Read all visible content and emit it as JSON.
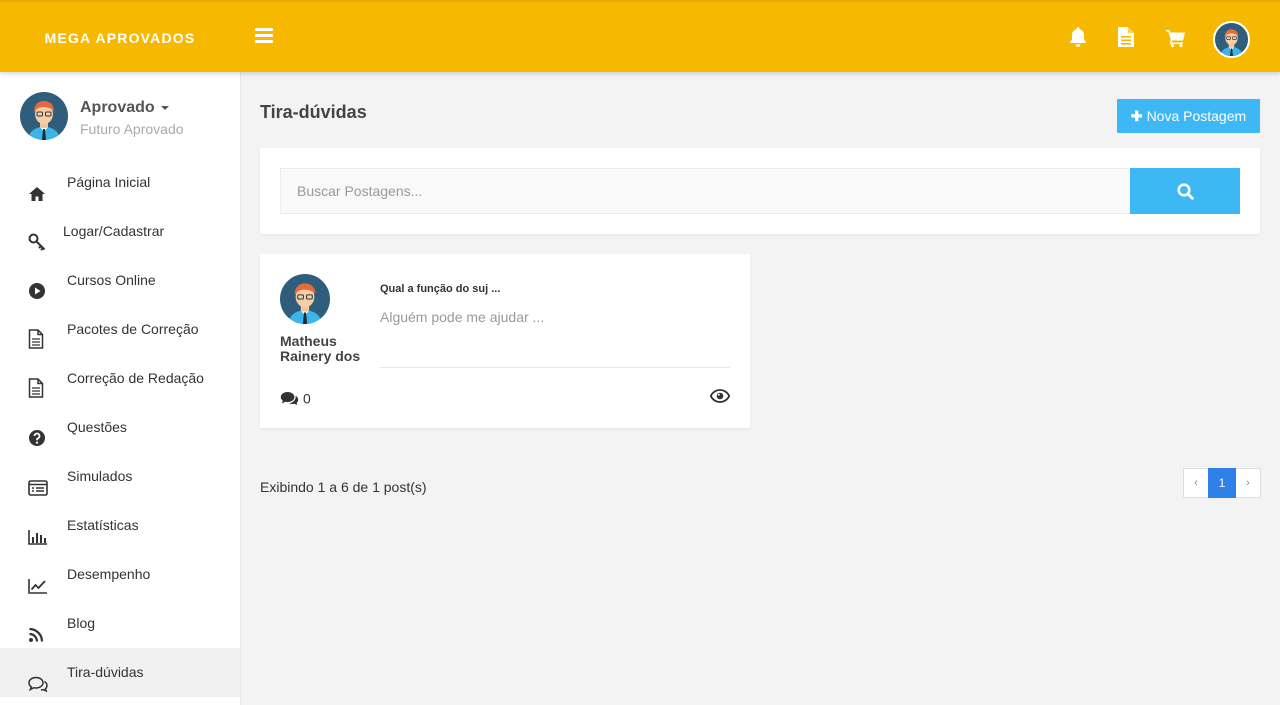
{
  "brand": "MEGA APROVADOS",
  "topbar": {
    "icons": [
      "bell-icon",
      "document-icon",
      "cart-icon"
    ],
    "color": "#f7b900"
  },
  "user": {
    "name": "Aprovado",
    "role": "Futuro Aprovado"
  },
  "sidebar": {
    "items": [
      {
        "label": "Página Inicial",
        "icon": "home-icon"
      },
      {
        "label": "Logar/Cadastrar",
        "icon": "key-icon"
      },
      {
        "label": "Cursos Online",
        "icon": "play-circle-icon"
      },
      {
        "label": "Pacotes de Correção",
        "icon": "file-text-icon"
      },
      {
        "label": "Correção de Redação",
        "icon": "file-text-icon"
      },
      {
        "label": "Questões",
        "icon": "question-circle-icon"
      },
      {
        "label": "Simulados",
        "icon": "list-alt-icon"
      },
      {
        "label": "Estatísticas",
        "icon": "bar-chart-icon"
      },
      {
        "label": "Desempenho",
        "icon": "line-chart-icon"
      },
      {
        "label": "Blog",
        "icon": "rss-icon"
      },
      {
        "label": "Tira-dúvidas",
        "icon": "comments-icon",
        "active": true
      }
    ]
  },
  "main": {
    "title": "Tira-dúvidas",
    "new_post_label": "Nova Postagem",
    "search": {
      "placeholder": "Buscar Postagens...",
      "value": ""
    },
    "posts": [
      {
        "author": "Matheus Rainery dos",
        "title": "Qual a função do suj ...",
        "excerpt": "Alguém pode me ajudar ...",
        "comments": "0"
      }
    ],
    "summary": "Exibindo 1 a 6 de 1 post(s)",
    "pagination": {
      "prev": "‹",
      "current": "1",
      "next": "›"
    }
  },
  "colors": {
    "accent": "#3db8f5",
    "pagination_active": "#2f80e7"
  }
}
